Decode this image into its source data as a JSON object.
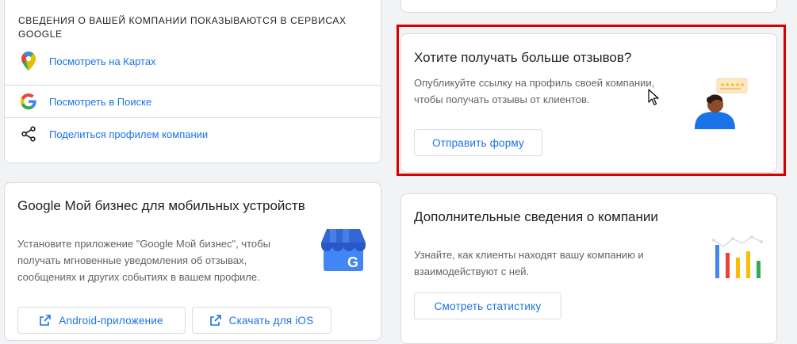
{
  "google_services": {
    "caption": "Сведения о вашей компании показываются в сервисах Google",
    "links": [
      {
        "label": "Посмотреть на Картах",
        "icon": "google-maps-pin-icon"
      },
      {
        "label": "Посмотреть в Поиске",
        "icon": "google-g-icon"
      },
      {
        "label": "Поделиться профилем компании",
        "icon": "share-icon"
      }
    ]
  },
  "reviews": {
    "title": "Хотите получать больше отзывов?",
    "description_line1": "Опубликуйте ссылку на профиль своей компании,",
    "description_line2": "чтобы получать отзывы от клиентов.",
    "button_label": "Отправить форму",
    "illustration": "person-review-illustration"
  },
  "mobile": {
    "title": "Google Мой бизнес для мобильных устройств",
    "description_line1": "Установите приложение \"Google Мой бизнес\", чтобы",
    "description_line2": "получать мгновенные уведомления об отзывах,",
    "description_line3": "сообщениях и других событиях в вашем профиле.",
    "android_label": "Android-приложение",
    "ios_label": "Скачать для iOS",
    "illustration": "google-my-business-store-icon"
  },
  "info": {
    "title": "Дополнительные сведения о компании",
    "description_line1": "Узнайте, как клиенты находят вашу компанию и",
    "description_line2": "взаимодействуют с ней.",
    "button_label": "Смотреть статистику",
    "illustration": "bar-chart-illustration"
  },
  "colors": {
    "link": "#1a73e8",
    "highlight": "#d90000",
    "google_blue": "#4285f4",
    "google_red": "#ea4335",
    "google_yellow": "#fbbc04",
    "google_green": "#34a853"
  }
}
